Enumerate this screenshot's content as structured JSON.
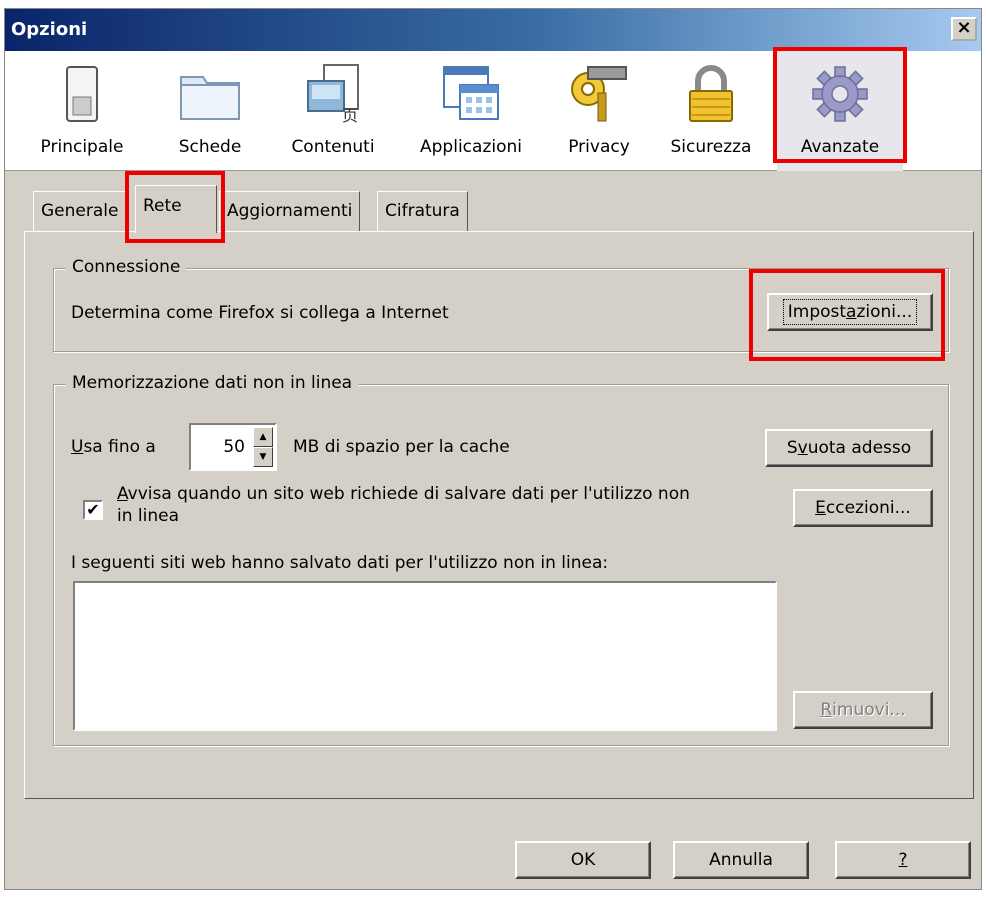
{
  "window": {
    "title": "Opzioni",
    "close_glyph": "×"
  },
  "categories": [
    {
      "label": "Principale",
      "icon": "switch-icon"
    },
    {
      "label": "Schede",
      "icon": "folder-tabs-icon"
    },
    {
      "label": "Contenuti",
      "icon": "documents-icon"
    },
    {
      "label": "Applicazioni",
      "icon": "window-calendar-icon"
    },
    {
      "label": "Privacy",
      "icon": "key-icon"
    },
    {
      "label": "Sicurezza",
      "icon": "lock-icon"
    },
    {
      "label": "Avanzate",
      "icon": "gear-icon"
    }
  ],
  "active_category": "Avanzate",
  "tabs": [
    {
      "label": "Generale"
    },
    {
      "label": "Rete"
    },
    {
      "label": "Aggiornamenti"
    },
    {
      "label": "Cifratura"
    }
  ],
  "active_tab": "Rete",
  "connection": {
    "legend": "Connessione",
    "description": "Determina come Firefox si collega a Internet",
    "settings_button": {
      "pre": "Impost",
      "key": "a",
      "post": "zioni..."
    }
  },
  "offline": {
    "legend": "Memorizzazione dati non in linea",
    "use_up_to": {
      "key": "U",
      "rest": "sa fino a"
    },
    "cache_value": "50",
    "cache_suffix": "MB di spazio per la cache",
    "clear_button": {
      "pre": "S",
      "key": "v",
      "post": "uota adesso"
    },
    "notify_checked": true,
    "check_glyph": "✔",
    "notify_label": {
      "key": "A",
      "rest": "vvisa quando un sito web richiede di salvare dati per l'utilizzo non",
      "line2": "in linea"
    },
    "exceptions_button": {
      "key": "E",
      "rest": "ccezioni..."
    },
    "sites_label": "I seguenti siti web hanno salvato dati per l'utilizzo non in linea:",
    "remove_button": {
      "key": "R",
      "rest": "imuovi..."
    }
  },
  "footer": {
    "ok": "OK",
    "cancel": "Annulla",
    "help": "?"
  },
  "annotations_color": "#ee0000"
}
